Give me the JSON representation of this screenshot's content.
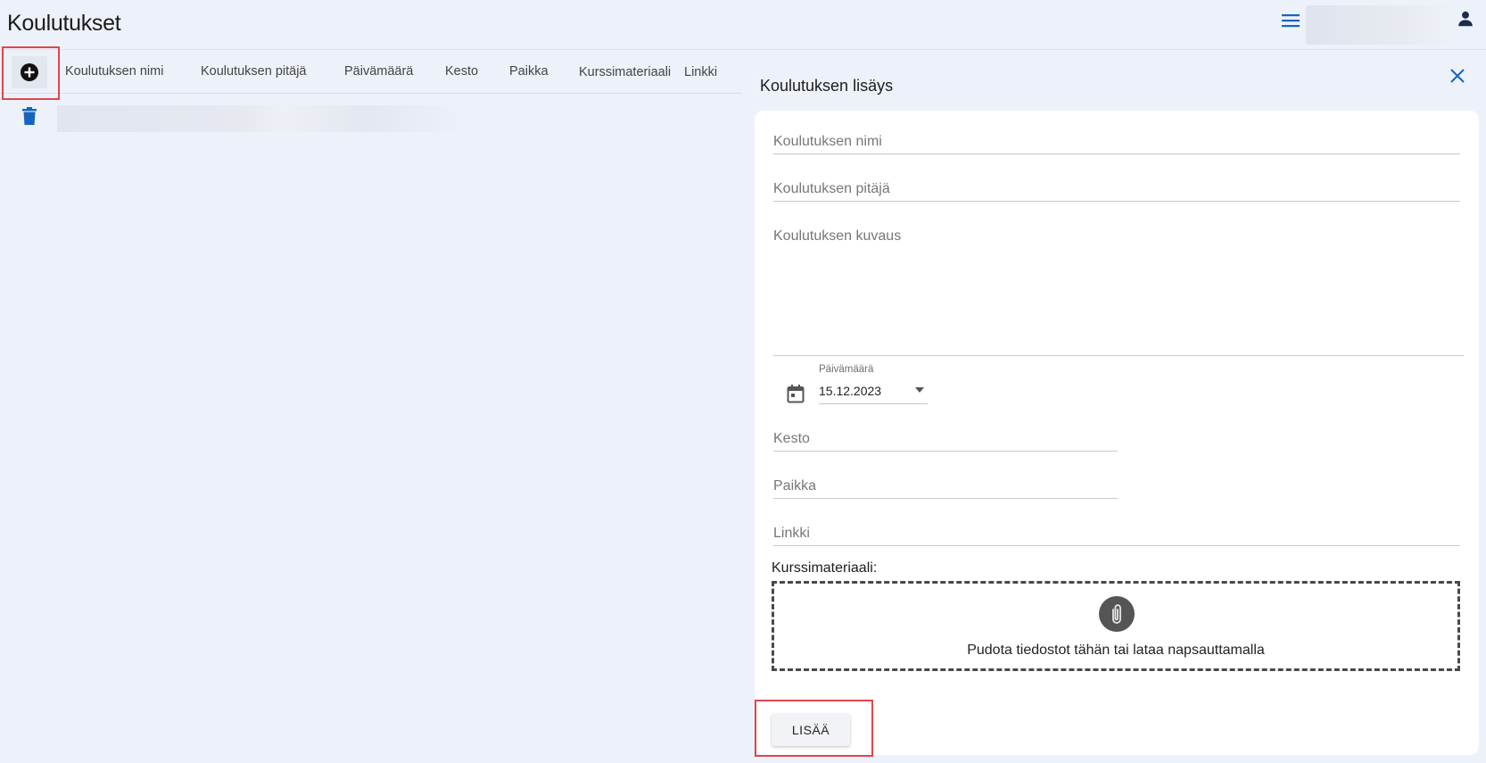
{
  "page": {
    "title": "Koulutukset"
  },
  "header": {
    "menu_icon": "hamburger-menu-icon",
    "user_icon": "account-icon"
  },
  "table": {
    "add_icon": "plus-circle-icon",
    "delete_icon": "trash-icon",
    "columns": [
      "Koulutuksen nimi",
      "Koulutuksen pitäjä",
      "Päivämäärä",
      "Kesto",
      "Paikka",
      "Kurssimateriaali",
      "Linkki"
    ]
  },
  "panel": {
    "title": "Koulutuksen lisäys",
    "close_icon": "close-icon",
    "fields": {
      "name_placeholder": "Koulutuksen nimi",
      "organizer_placeholder": "Koulutuksen pitäjä",
      "description_placeholder": "Koulutuksen kuvaus",
      "date_label": "Päivämäärä",
      "date_value": "15.12.2023",
      "duration_placeholder": "Kesto",
      "location_placeholder": "Paikka",
      "link_placeholder": "Linkki"
    },
    "material_label": "Kurssimateriaali:",
    "dropzone_text": "Pudota tiedostot tähän tai lataa napsauttamalla",
    "submit_label": "LISÄÄ"
  },
  "colors": {
    "accent": "#1565c0",
    "highlight": "#e0454a",
    "background": "#edf1f9"
  }
}
